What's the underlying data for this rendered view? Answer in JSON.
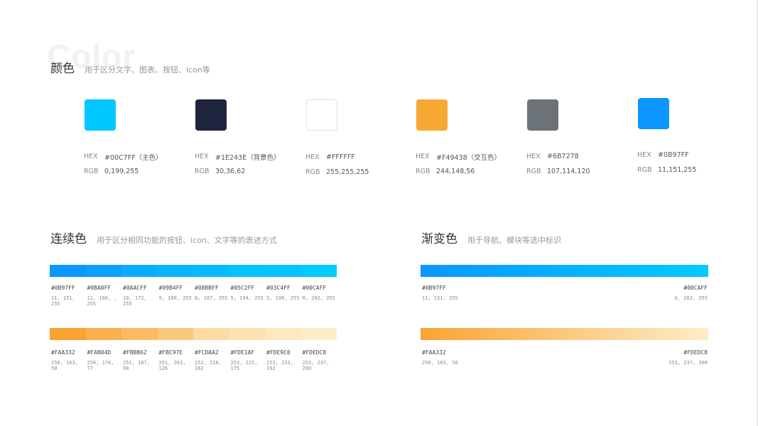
{
  "color_section": {
    "watermark": "Color",
    "title": "颜色",
    "subtitle": "用于区分文字、图表、按钮、icon等",
    "swatches": [
      {
        "hex_label": "HEX",
        "hex": "#00C7FF（主色）",
        "rgb_label": "RGB",
        "rgb": "0,199,255",
        "color": "#00C7FF"
      },
      {
        "hex_label": "HEX",
        "hex": "#1E243E（背景色）",
        "rgb_label": "RGB",
        "rgb": "30,36,62",
        "color": "#1E243E"
      },
      {
        "hex_label": "HEX",
        "hex": "#FFFFFF",
        "rgb_label": "RGB",
        "rgb": "255,255,255",
        "color": "#FFFFFF"
      },
      {
        "hex_label": "HEX",
        "hex": "#F49438（交互色）",
        "rgb_label": "RGB",
        "rgb": "244,148,56",
        "color": "#F7A832"
      },
      {
        "hex_label": "HEX",
        "hex": "#6B7278",
        "rgb_label": "RGB",
        "rgb": "107,114,120",
        "color": "#6B7278"
      },
      {
        "hex_label": "HEX",
        "hex": "#0B97FF",
        "rgb_label": "RGB",
        "rgb": "11,151,255",
        "color": "#0B97FF"
      }
    ]
  },
  "continuous_section": {
    "title": "连续色",
    "subtitle": "用于区分相同功能的按钮、icon、文字等的表述方式",
    "blue_scale": [
      {
        "hex": "#0B97FF",
        "rgb": "11, 151, 255",
        "color": "#0B97FF"
      },
      {
        "hex": "#0BA0FF",
        "rgb": "11, 160, , 255",
        "color": "#0BA0FF"
      },
      {
        "hex": "#0AACFF",
        "rgb": "10, 172, 255",
        "color": "#0AACFF"
      },
      {
        "hex": "#09B4FF",
        "rgb": "9, 180, 255",
        "color": "#09B4FF"
      },
      {
        "hex": "#08BBFF",
        "rgb": "8, 187, 255",
        "color": "#08BBFF"
      },
      {
        "hex": "#05C2FF",
        "rgb": "5, 194, 255",
        "color": "#05C2FF"
      },
      {
        "hex": "#03C4FF",
        "rgb": "3, 196, 255",
        "color": "#03C4FF"
      },
      {
        "hex": "#00CAFF",
        "rgb": "0, 202, 255",
        "color": "#00CAFF"
      }
    ],
    "orange_scale": [
      {
        "hex": "#FAA332",
        "rgb": "250, 163, 50",
        "color": "#FAA332"
      },
      {
        "hex": "#FAB04D",
        "rgb": "250, 176, 77",
        "color": "#FAB04D"
      },
      {
        "hex": "#FBBB62",
        "rgb": "251, 187, 98",
        "color": "#FBBB62"
      },
      {
        "hex": "#FBC97E",
        "rgb": "251, 201, 126",
        "color": "#FBC97E"
      },
      {
        "hex": "#FCDAA2",
        "rgb": "252, 218, 162",
        "color": "#FCDAA2"
      },
      {
        "hex": "#FDE1AF",
        "rgb": "253, 225, 175",
        "color": "#FDE1AF"
      },
      {
        "hex": "#FDE9C0",
        "rgb": "253, 233, 192",
        "color": "#FDE9C0"
      },
      {
        "hex": "#FDEDC8",
        "rgb": "253, 237, 200",
        "color": "#FDEDC8"
      }
    ]
  },
  "gradient_section": {
    "title": "渐变色",
    "subtitle": "用于导航、模块等选中标识",
    "blue": {
      "start": {
        "hex": "#0B97FF",
        "rgb": "11, 151, 255",
        "color": "#0B97FF"
      },
      "end": {
        "hex": "#00CAFF",
        "rgb": "0, 202, 255",
        "color": "#00CAFF"
      }
    },
    "orange": {
      "start": {
        "hex": "#FAA332",
        "rgb": "250, 163, 50",
        "color": "#FAA332"
      },
      "end": {
        "hex": "#FDEDC8",
        "rgb": "253, 237, 200",
        "color": "#FDEDC8"
      }
    }
  }
}
